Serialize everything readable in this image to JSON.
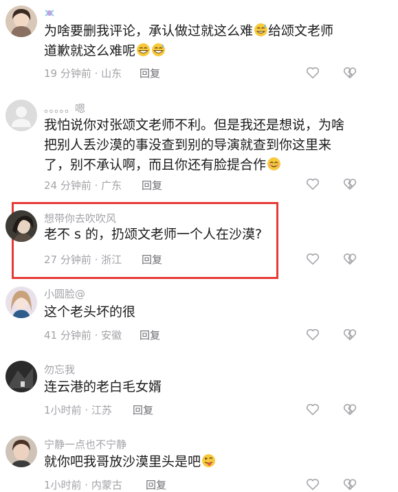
{
  "comments": [
    {
      "username": "",
      "text": "为啥要删我评论，承认做过就这么难",
      "text2": "给颂文老师道歉就这么难呢",
      "meta": "19 分钟前 · 山东",
      "reply": "回复",
      "avatar_icon": "woman-avatar"
    },
    {
      "username": "。。。。。嗯",
      "text": "我怕说你对张颂文老师不利。但是我还是想说，为啥把别人丢沙漠的事没查到别的导演就查到你这里来了，别不承认啊，而且你还有脸提合作",
      "meta": "24 分钟前 · 广东",
      "reply": "回复",
      "avatar_icon": "default-avatar"
    },
    {
      "username": "想带你去吹吹风",
      "text": "老不 s 的，扔颂文老师一个人在沙漠?",
      "meta": "27 分钟前 · 浙江",
      "reply": "回复",
      "avatar_icon": "woman-avatar"
    },
    {
      "username": "小圆脸@",
      "text": "这个老头坏的很",
      "meta": "41 分钟前 · 安徽",
      "reply": "回复",
      "avatar_icon": "girl-avatar"
    },
    {
      "username": "勿忘我",
      "text": "连云港的老白毛女婿",
      "meta": "1小时前 · 江苏",
      "reply": "回复",
      "avatar_icon": "dark-avatar"
    },
    {
      "username": "宁静一点也不宁静",
      "text": "就你吧我哥放沙漠里头是吧",
      "meta": "1小时前 · 内蒙古",
      "reply": "回复",
      "avatar_icon": "man-avatar"
    }
  ],
  "colors": {
    "highlight": "#e53935",
    "meta": "#a3a3a8",
    "text": "#1a1a1a"
  }
}
